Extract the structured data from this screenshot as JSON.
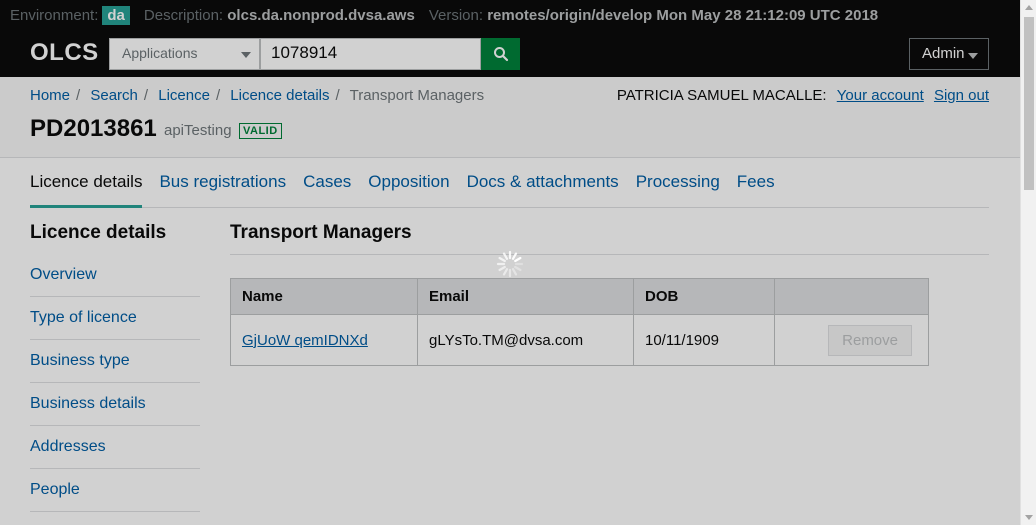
{
  "env_bar": {
    "env_label": "Environment:",
    "env_value": "da",
    "desc_label": "Description:",
    "desc_value": "olcs.da.nonprod.dvsa.aws",
    "version_label": "Version:",
    "version_value": "remotes/origin/develop Mon May 28 21:12:09 UTC 2018"
  },
  "header": {
    "logo": "OLCS",
    "search_select": "Applications",
    "search_value": "1078914",
    "search_icon": "search-icon",
    "admin_label": "Admin"
  },
  "breadcrumbs": [
    {
      "label": "Home"
    },
    {
      "label": "Search"
    },
    {
      "label": "Licence"
    },
    {
      "label": "Licence details"
    },
    {
      "label": "Transport Managers"
    }
  ],
  "user": {
    "name": "PATRICIA SAMUEL MACALLE:",
    "account_link": "Your account",
    "signout_link": "Sign out"
  },
  "licence": {
    "number": "PD2013861",
    "name": "apiTesting",
    "status": "VALID"
  },
  "tabs": [
    {
      "label": "Licence details",
      "active": true
    },
    {
      "label": "Bus registrations"
    },
    {
      "label": "Cases"
    },
    {
      "label": "Opposition"
    },
    {
      "label": "Docs & attachments"
    },
    {
      "label": "Processing"
    },
    {
      "label": "Fees"
    }
  ],
  "sidebar": {
    "title": "Licence details",
    "items": [
      {
        "label": "Overview"
      },
      {
        "label": "Type of licence"
      },
      {
        "label": "Business type"
      },
      {
        "label": "Business details"
      },
      {
        "label": "Addresses"
      },
      {
        "label": "People"
      }
    ]
  },
  "main": {
    "title": "Transport Managers",
    "table": {
      "headers": [
        "Name",
        "Email",
        "DOB",
        ""
      ],
      "rows": [
        {
          "name": "GjUoW qemIDNXd",
          "email": "gLYsTo.TM@dvsa.com",
          "dob": "10/11/1909",
          "action": "Remove"
        }
      ]
    }
  },
  "colors": {
    "accent": "#28a197",
    "link": "#005ea5",
    "header_bg": "#0b0c0c",
    "status_green": "#00823b"
  },
  "loading": true
}
